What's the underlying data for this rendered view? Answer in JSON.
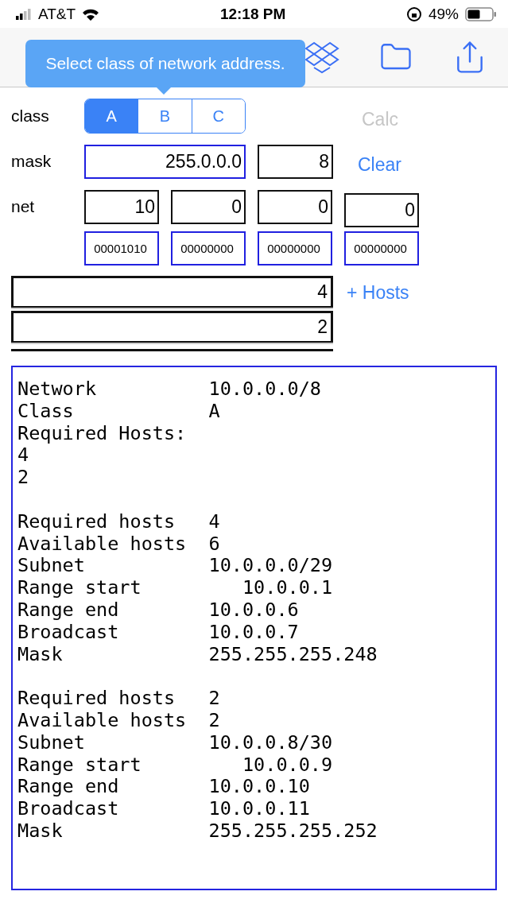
{
  "status_bar": {
    "carrier": "AT&T",
    "time": "12:18 PM",
    "battery": "49%"
  },
  "tooltip": {
    "text": "Select class of network address."
  },
  "class_row": {
    "label": "class",
    "segments": [
      {
        "label": "A",
        "selected": true
      },
      {
        "label": "B",
        "selected": false
      },
      {
        "label": "C",
        "selected": false
      }
    ],
    "calc": {
      "label": "Calc",
      "disabled": true
    }
  },
  "mask_row": {
    "label": "mask",
    "mask": "255.0.0.0",
    "prefix": "8",
    "clear": "Clear"
  },
  "net_row": {
    "label": "net",
    "octets": [
      "10",
      "0",
      "0",
      "0"
    ],
    "binary": [
      "00001010",
      "00000000",
      "00000000",
      "00000000"
    ]
  },
  "hosts": {
    "values": [
      "4",
      "2"
    ],
    "add": "+ Hosts"
  },
  "output": [
    [
      {
        "kind": "pair",
        "label": "Network",
        "value": "10.0.0.0/8"
      },
      {
        "kind": "pair",
        "label": "Class",
        "value": "A"
      },
      {
        "kind": "single",
        "label": "Required Hosts:"
      },
      {
        "kind": "single",
        "label": "4"
      },
      {
        "kind": "single",
        "label": "2"
      }
    ],
    [
      {
        "kind": "pair",
        "label": "Required hosts",
        "value": "4"
      },
      {
        "kind": "pair",
        "label": "Available hosts",
        "value": "6"
      },
      {
        "kind": "pair",
        "label": "Subnet",
        "value": "10.0.0.0/29"
      },
      {
        "kind": "shifted",
        "label": "Range start",
        "value": "10.0.0.1"
      },
      {
        "kind": "pair",
        "label": "Range end",
        "value": "10.0.0.6"
      },
      {
        "kind": "pair",
        "label": "Broadcast",
        "value": "10.0.0.7"
      },
      {
        "kind": "pair",
        "label": "Mask",
        "value": "255.255.255.248"
      }
    ],
    [
      {
        "kind": "pair",
        "label": "Required hosts",
        "value": "2"
      },
      {
        "kind": "pair",
        "label": "Available hosts",
        "value": "2"
      },
      {
        "kind": "pair",
        "label": "Subnet",
        "value": "10.0.0.8/30"
      },
      {
        "kind": "shifted",
        "label": "Range start",
        "value": "10.0.0.9"
      },
      {
        "kind": "pair",
        "label": "Range end",
        "value": "10.0.0.10"
      },
      {
        "kind": "pair",
        "label": "Broadcast",
        "value": "10.0.0.11"
      },
      {
        "kind": "pair",
        "label": "Mask",
        "value": "255.255.255.252"
      }
    ]
  ]
}
